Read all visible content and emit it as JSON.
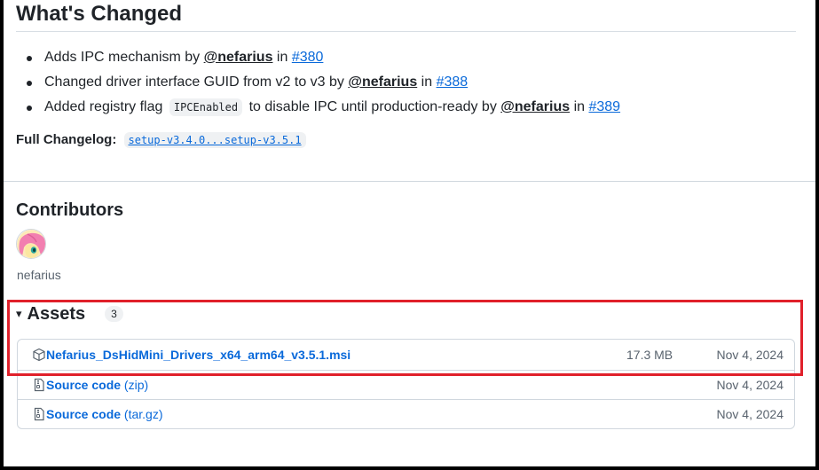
{
  "release": {
    "whats_changed_heading": "What's Changed",
    "changes": [
      {
        "text_before": "Adds IPC mechanism by ",
        "author": "@nefarius",
        "in_word": " in ",
        "pr": "#380"
      },
      {
        "text_before": "Changed driver interface GUID from v2 to v3 by ",
        "author": "@nefarius",
        "in_word": " in ",
        "pr": "#388"
      },
      {
        "text_before": "Added registry flag",
        "code": "IPCEnabled",
        "text_after": "to disable IPC until production-ready by ",
        "author": "@nefarius",
        "in_word": " in ",
        "pr": "#389"
      }
    ],
    "changelog": {
      "label": "Full Changelog:",
      "link": "setup-v3.4.0...setup-v3.5.1"
    },
    "contributors": {
      "heading": "Contributors",
      "people": [
        {
          "name": "nefarius"
        }
      ]
    },
    "assets": {
      "caret": "▾",
      "heading": "Assets",
      "count": "3",
      "items": [
        {
          "icon": "package-icon",
          "name": "Nefarius_DsHidMini_Drivers_x64_arm64_v3.5.1.msi",
          "suffix": "",
          "size": "17.3 MB",
          "date": "Nov 4, 2024"
        },
        {
          "icon": "file-zip-icon",
          "name": "Source code",
          "suffix": "(zip)",
          "size": "",
          "date": "Nov 4, 2024"
        },
        {
          "icon": "file-zip-icon",
          "name": "Source code",
          "suffix": "(tar.gz)",
          "size": "",
          "date": "Nov 4, 2024"
        }
      ]
    }
  },
  "colors": {
    "link": "#0969da",
    "highlight": "#e0202a",
    "muted": "#59636e",
    "border": "#d0d7de"
  }
}
